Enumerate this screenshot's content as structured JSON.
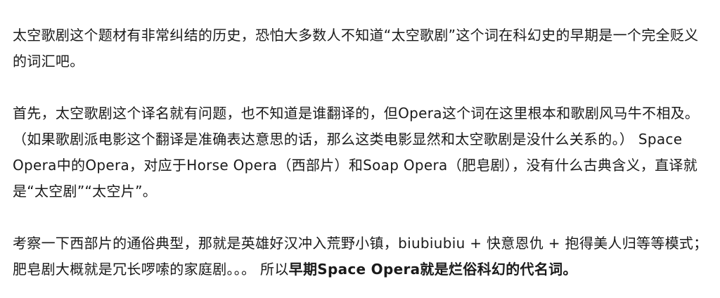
{
  "article": {
    "paragraph_1": "太空歌剧这个题材有非常纠结的历史，恐怕大多数人不知道“太空歌剧”这个词在科幻史的早期是一个完全贬义的词汇吧。",
    "paragraph_2": "首先，太空歌剧这个译名就有问题，也不知道是谁翻译的，但Opera这个词在这里根本和歌剧风马牛不相及。（如果歌剧派电影这个翻译是准确表达意思的话，那么这类电影显然和太空歌剧是没什么关系的。） Space Opera中的Opera，对应于Horse Opera（西部片）和Soap Opera（肥皂剧），没有什么古典含义，直译就是“太空剧”“太空片”。",
    "paragraph_3_plain": "考察一下西部片的通俗典型，那就是英雄好汉冲入荒野小镇，biubiubiu + 快意恩仇 + 抱得美人归等等模式； 肥皂剧大概就是冗长啰嗦的家庭剧。。。 所以",
    "paragraph_3_bold": "早期Space Opera就是烂俗科幻的代名词。"
  }
}
